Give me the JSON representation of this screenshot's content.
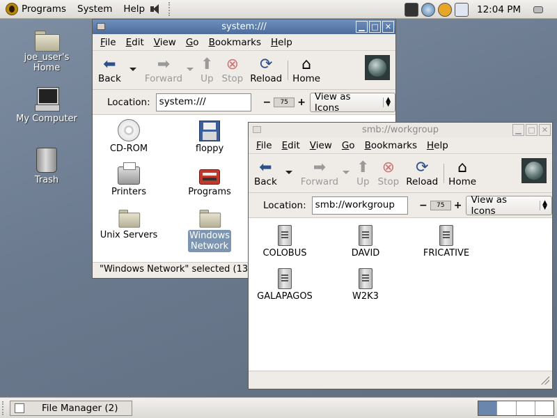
{
  "top_panel": {
    "menus": [
      "Programs",
      "System",
      "Help"
    ],
    "clock": "12:04 PM"
  },
  "desktop": {
    "icons": [
      {
        "label_line1": "joe_user's",
        "label_line2": "Home"
      },
      {
        "label_line1": "My Computer"
      },
      {
        "label_line1": "Trash"
      }
    ]
  },
  "win1": {
    "title": "system:///",
    "menu": [
      "File",
      "Edit",
      "View",
      "Go",
      "Bookmarks",
      "Help"
    ],
    "toolbar": {
      "back": "Back",
      "forward": "Forward",
      "up": "Up",
      "stop": "Stop",
      "reload": "Reload",
      "home": "Home"
    },
    "location_label": "Location:",
    "location_value": "system:///",
    "zoom": "75",
    "view_mode": "View as Icons",
    "items": [
      "CD-ROM",
      "floppy",
      "Printers",
      "Programs",
      "Unix Servers",
      "Windows",
      "Network"
    ],
    "status": "\"Windows Network\" selected (13"
  },
  "win2": {
    "title": "smb://workgroup",
    "menu": [
      "File",
      "Edit",
      "View",
      "Go",
      "Bookmarks",
      "Help"
    ],
    "toolbar": {
      "back": "Back",
      "forward": "Forward",
      "up": "Up",
      "stop": "Stop",
      "reload": "Reload",
      "home": "Home"
    },
    "location_label": "Location:",
    "location_value": "smb://workgroup",
    "zoom": "75",
    "view_mode": "View as Icons",
    "items": [
      "COLOBUS",
      "DAVID",
      "FRICATIVE",
      "GALAPAGOS",
      "W2K3"
    ]
  },
  "taskbar": {
    "task_label": "File Manager (2)"
  }
}
